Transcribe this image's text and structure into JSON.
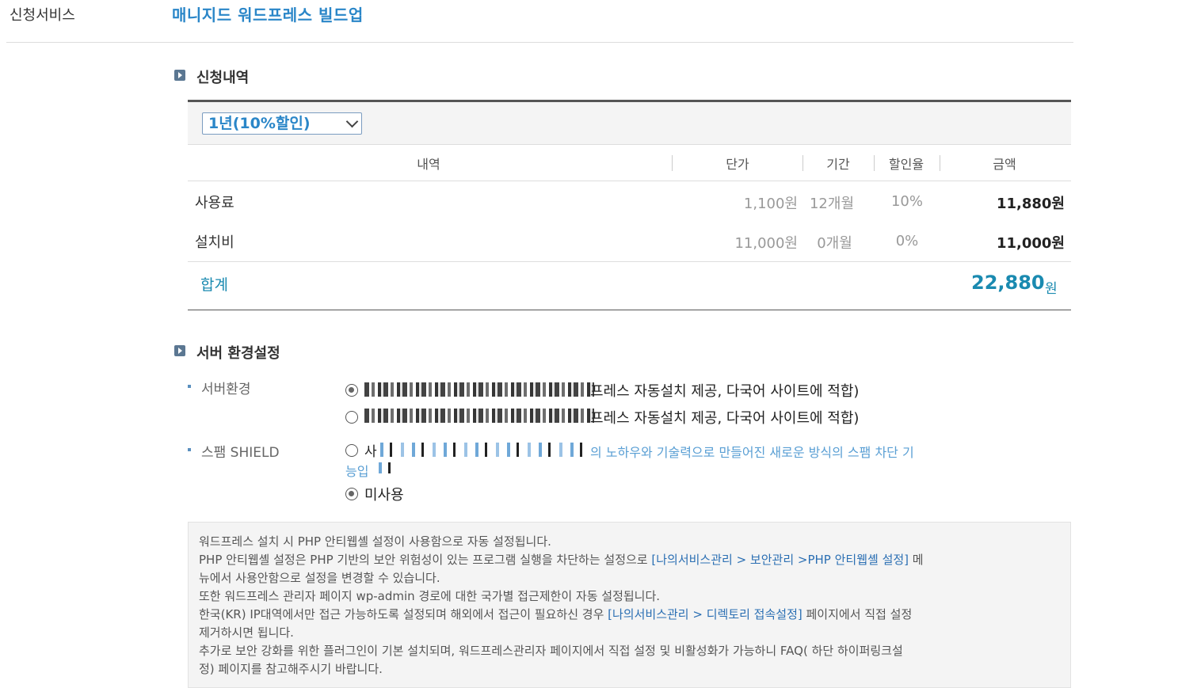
{
  "service": {
    "label": "신청서비스",
    "name": "매니지드 워드프레스 빌드업"
  },
  "order": {
    "section_title": "신청내역",
    "period_selected": "1년(10%할인)",
    "columns": [
      "내역",
      "단가",
      "기간",
      "할인율",
      "금액"
    ],
    "rows": [
      {
        "name": "사용료",
        "unit_price": "1,100원",
        "period": "12개월",
        "discount": "10%",
        "amount": "11,880원"
      },
      {
        "name": "설치비",
        "unit_price": "11,000원",
        "period": "0개월",
        "discount": "0%",
        "amount": "11,000원"
      }
    ],
    "total_label": "합계",
    "total_value": "22,880",
    "total_unit": "원"
  },
  "server": {
    "section_title": "서버 환경설정",
    "env_label": "서버환경",
    "env_options": [
      {
        "visible_text": "프레스 자동설치 제공, 다국어 사이트에 적합)",
        "selected": true
      },
      {
        "visible_text": "프레스 자동설치 제공, 다국어 사이트에 적합)",
        "selected": false
      }
    ],
    "spam_label": "스팸 SHIELD",
    "spam_option_prefix": "사",
    "spam_desc_line1": "의 노하우와 기술력으로 만들어진 새로운 방식의 스팸 차단 기",
    "spam_desc_line2": "능입",
    "spam_unused_label": "미사용",
    "spam_unused_selected": true
  },
  "notice": {
    "line1": "워드프레스 설치 시 PHP 안티웹셸 설정이 사용함으로 자동 설정됩니다.",
    "line2_pre": "PHP 안티웹셸 설정은 PHP 기반의 보안 위험성이 있는 프로그램 실행을 차단하는 설정으로 ",
    "line2_link": "[나의서비스관리 > 보안관리 >PHP 안티웹셸 설정]",
    "line2_post": " 메",
    "line3": "뉴에서 사용안함으로 설정을 변경할 수 있습니다.",
    "line4": "또한 워드프레스 관리자 페이지 wp-admin 경로에 대한 국가별 접근제한이 자동 설정됩니다.",
    "line5_pre": "한국(KR) IP대역에서만 접근 가능하도록 설정되며 해외에서 접근이 필요하신 경우 ",
    "line5_link": "[나의서비스관리 > 디렉토리 접속설정]",
    "line5_post": " 페이지에서 직접 설정",
    "line6": "제거하시면 됩니다.",
    "line7": "추가로 보안 강화를 위한 플러그인이 기본 설치되며, 워드프레스관리자 페이지에서 직접 설정 및 비활성화가 가능하니 FAQ( 하단 하이퍼링크설",
    "line8": "정) 페이지를 참고해주시기 바랍니다."
  }
}
